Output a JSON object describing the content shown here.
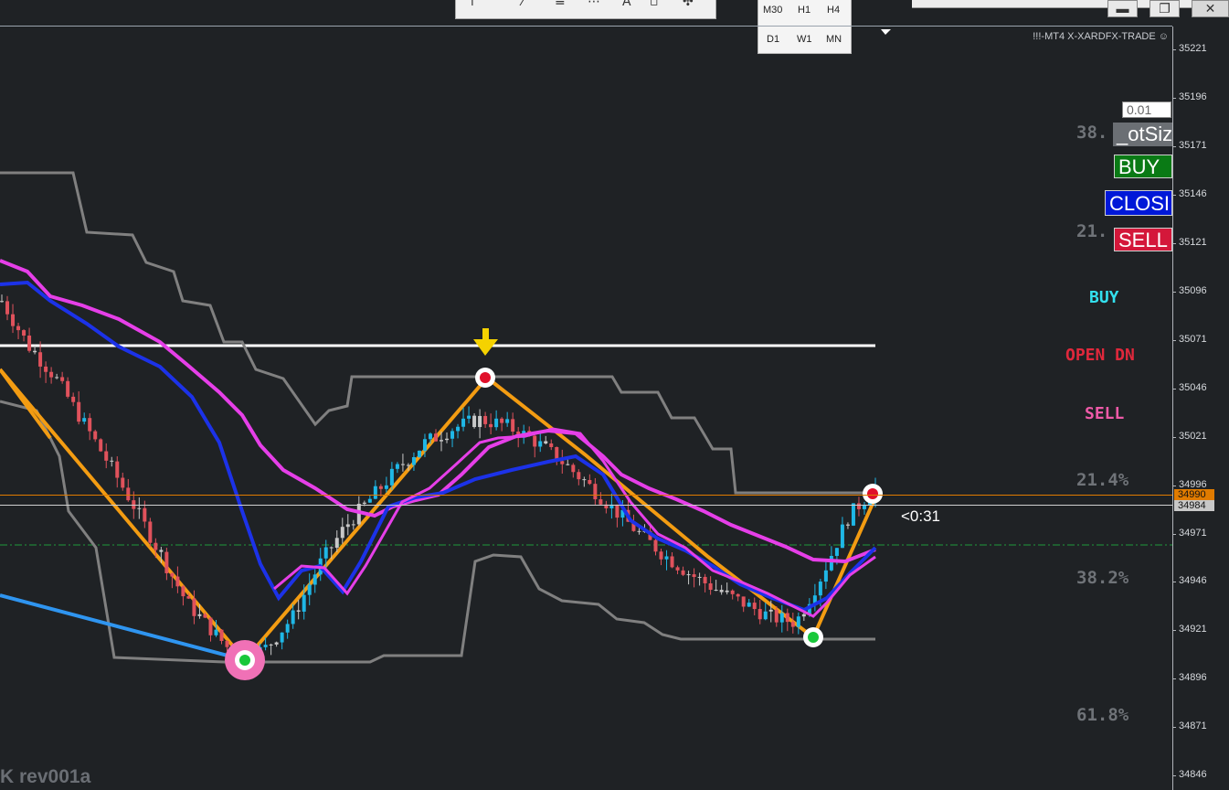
{
  "toolbar": {
    "icons": [
      "cursor-icon",
      "trendline-icon",
      "fibo-icon",
      "fibo-fan-icon",
      "text-icon",
      "label-icon",
      "arrows-icon"
    ]
  },
  "timeframes": {
    "row1": [
      "M30",
      "H1",
      "H4"
    ],
    "row2": [
      "D1",
      "W1",
      "MN"
    ]
  },
  "window": {
    "minimize": "▬",
    "restore": "❐",
    "close": "✕"
  },
  "brand": "!!!-MT4 X-XARDFX-TRADE ☺",
  "fib_labels": [
    "38.",
    "21.",
    "21.4%",
    "38.2%",
    "61.8%"
  ],
  "panel": {
    "lot_value": "0.01",
    "lotsize_label": "_otSiz",
    "buy_label": "BUY",
    "close_label": "CLOSI",
    "sell_label": "SELL",
    "colors": {
      "lotsize": "#6b6f74",
      "buy": "#0a7a15",
      "close": "#0018d8",
      "sell": "#d4173a"
    }
  },
  "signals": {
    "buy": "BUY",
    "open_dn": "OPEN DN",
    "sell": "SELL",
    "colors": {
      "buy": "#33e0ee",
      "open_dn": "#e0283c",
      "sell": "#ee5aa8"
    }
  },
  "price_axis": {
    "ticks": [
      "35221",
      "35196",
      "35171",
      "35146",
      "35121",
      "35096",
      "35071",
      "35046",
      "35021",
      "34996",
      "34971",
      "34946",
      "34921",
      "34896",
      "34871",
      "34846"
    ],
    "bid": "34990",
    "ask": "34984"
  },
  "countdown": "<0:31",
  "footer": "K rev001a",
  "chart_data": {
    "type": "candlestick",
    "ylim": [
      34846,
      35221
    ],
    "bid_color": "#ff8c00",
    "bull_color": "#1fb7e6",
    "bear_color": "#e0525c",
    "neutral_color": "#c8c8c8",
    "series": [
      {
        "values": [
          35091,
          35068,
          35052,
          35030,
          35008,
          34985,
          34960,
          34935,
          34920,
          34905,
          34912,
          34928,
          34955,
          34975,
          34990,
          35005,
          35018,
          35025,
          35030,
          35027,
          35020,
          35010,
          34998,
          34985,
          34972,
          34960,
          34950,
          34942,
          34935,
          34928,
          34925,
          34950,
          34980,
          34995
        ]
      }
    ]
  }
}
